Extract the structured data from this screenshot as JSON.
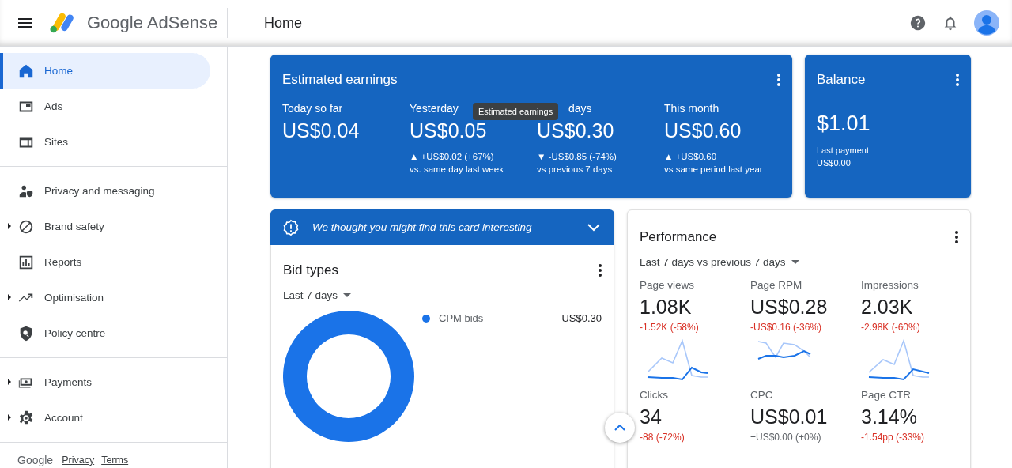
{
  "app": {
    "brand": "Google AdSense",
    "page_title": "Home"
  },
  "sidebar": {
    "sections": [
      {
        "items": [
          {
            "label": "Home",
            "selected": true,
            "expandable": false
          },
          {
            "label": "Ads",
            "selected": false,
            "expandable": false
          },
          {
            "label": "Sites",
            "selected": false,
            "expandable": false
          }
        ]
      },
      {
        "items": [
          {
            "label": "Privacy and messaging",
            "selected": false,
            "expandable": false
          },
          {
            "label": "Brand safety",
            "selected": false,
            "expandable": true
          },
          {
            "label": "Reports",
            "selected": false,
            "expandable": false
          },
          {
            "label": "Optimisation",
            "selected": false,
            "expandable": true
          },
          {
            "label": "Policy centre",
            "selected": false,
            "expandable": false
          }
        ]
      },
      {
        "items": [
          {
            "label": "Payments",
            "selected": false,
            "expandable": true
          },
          {
            "label": "Account",
            "selected": false,
            "expandable": true
          }
        ]
      }
    ],
    "footer": {
      "brand": "Google",
      "links": [
        "Privacy",
        "Terms"
      ]
    }
  },
  "earnings": {
    "title": "Estimated earnings",
    "tooltip": "Estimated earnings",
    "columns": [
      {
        "label": "Today so far",
        "value": "US$0.04"
      },
      {
        "label": "Yesterday",
        "value": "US$0.05",
        "change": "▲ +US$0.02 (+67%)",
        "comparison": "vs. same day last week"
      },
      {
        "label": "days",
        "value": "US$0.30",
        "change": "▼ -US$0.85 (-74%)",
        "comparison": "vs previous 7 days"
      },
      {
        "label": "This month",
        "value": "US$0.60",
        "change": "▲ +US$0.60",
        "comparison": "vs same period last year"
      }
    ]
  },
  "balance": {
    "title": "Balance",
    "value": "$1.01",
    "note_label": "Last payment",
    "note_value": "US$0.00"
  },
  "suggestion": {
    "text": "We thought you might find this card interesting",
    "expanded": false
  },
  "bid_types": {
    "title": "Bid types",
    "range": "Last 7 days",
    "legend": [
      {
        "label": "CPM bids",
        "value": "US$0.30",
        "color": "#1a73e8"
      }
    ]
  },
  "performance": {
    "title": "Performance",
    "range": "Last 7 days vs previous 7 days",
    "metrics": [
      {
        "label": "Page views",
        "value": "1.08K",
        "change": "-1.52K (-58%)",
        "color": "#d93025",
        "kind": "sparkline"
      },
      {
        "label": "Page RPM",
        "value": "US$0.28",
        "change": "-US$0.16 (-36%)",
        "color": "#d93025",
        "kind": "sparkline"
      },
      {
        "label": "Impressions",
        "value": "2.03K",
        "change": "-2.98K (-60%)",
        "color": "#d93025",
        "kind": "sparkline"
      },
      {
        "label": "Clicks",
        "value": "34",
        "change": "-88 (-72%)",
        "color": "#d93025",
        "kind": "plain"
      },
      {
        "label": "CPC",
        "value": "US$0.01",
        "change": "+US$0.00 (+0%)",
        "color": "#5f6368",
        "kind": "plain"
      },
      {
        "label": "Page CTR",
        "value": "3.14%",
        "change": "-1.54pp (-33%)",
        "color": "#d93025",
        "kind": "plain"
      }
    ]
  }
}
